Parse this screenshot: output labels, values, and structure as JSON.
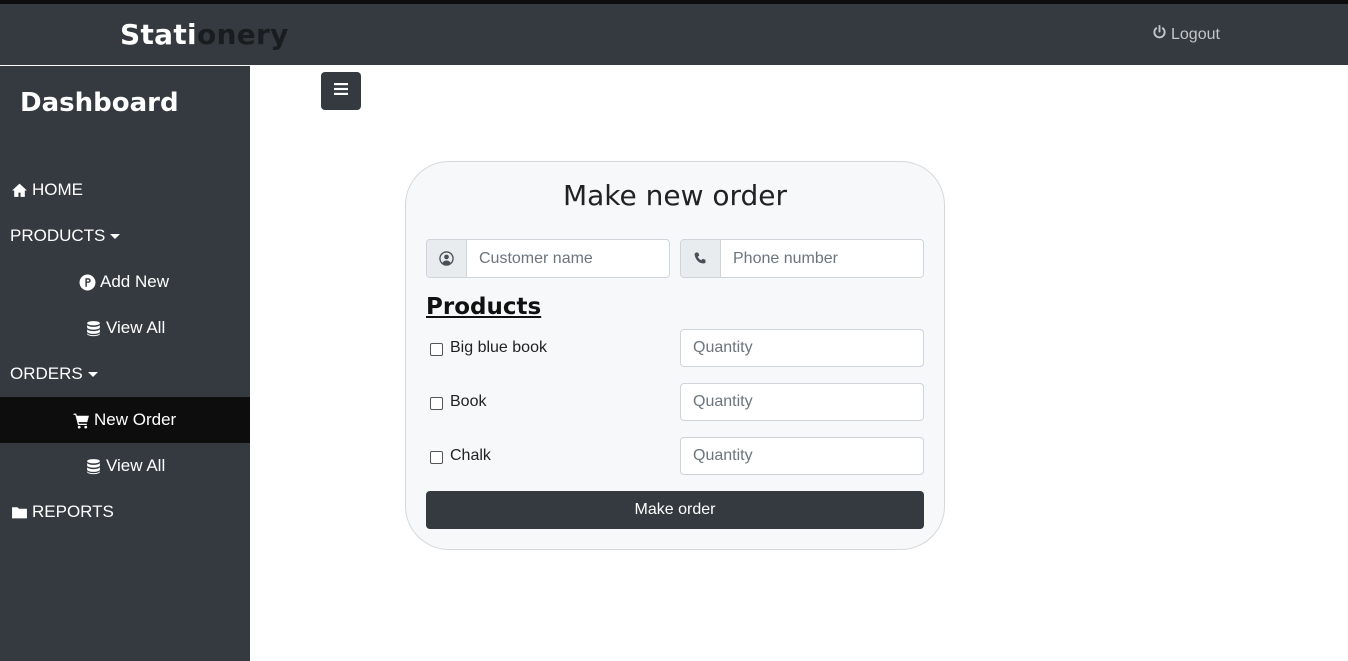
{
  "navbar": {
    "brand_part1": "Stati",
    "brand_part2": "onery",
    "logout_label": "Logout"
  },
  "sidebar": {
    "title": "Dashboard",
    "items": [
      {
        "label": "HOME",
        "icon": "home-icon"
      },
      {
        "label": "PRODUCTS",
        "icon": "none"
      },
      {
        "label": "Add New",
        "icon": "p-circle-icon"
      },
      {
        "label": "View All",
        "icon": "database-icon"
      },
      {
        "label": "ORDERS",
        "icon": "none"
      },
      {
        "label": "New Order",
        "icon": "cart-icon"
      },
      {
        "label": "View All",
        "icon": "database-icon"
      },
      {
        "label": "REPORTS",
        "icon": "folder-icon"
      }
    ]
  },
  "form": {
    "title": "Make new order",
    "customer_placeholder": "Customer name",
    "phone_placeholder": "Phone number",
    "products_heading": "Products",
    "quantity_placeholder": "Quantity",
    "products": [
      {
        "name": "Big blue book"
      },
      {
        "name": "Book"
      },
      {
        "name": "Chalk"
      }
    ],
    "submit_label": "Make order"
  },
  "colors": {
    "navbar": "#343a40",
    "sidebar": "#343a40",
    "active_item": "#0d0d0d",
    "card_bg": "#f7f8f9"
  }
}
